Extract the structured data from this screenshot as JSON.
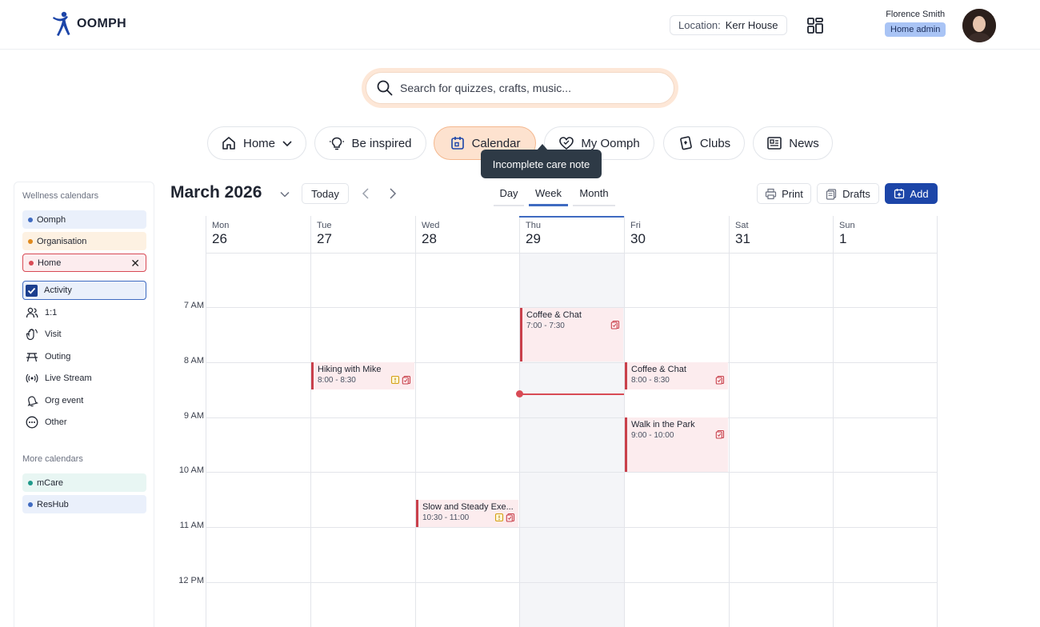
{
  "header": {
    "brand": "OOMPH",
    "location_label": "Location:",
    "location_value": "Kerr House",
    "user_name": "Florence Smith",
    "user_role": "Home admin"
  },
  "search": {
    "placeholder": "Search for quizzes, crafts, music..."
  },
  "nav": [
    {
      "label": "Home",
      "icon": "home-icon"
    },
    {
      "label": "Be inspired",
      "icon": "lightbulb-icon"
    },
    {
      "label": "Calendar",
      "icon": "calendar-icon",
      "active": true
    },
    {
      "label": "My Oomph",
      "icon": "heart-icon"
    },
    {
      "label": "Clubs",
      "icon": "clubs-icon"
    },
    {
      "label": "News",
      "icon": "newspaper-icon"
    }
  ],
  "tooltip": "Incomplete care note",
  "sidebar": {
    "wellness_heading": "Wellness calendars",
    "wellness": [
      {
        "label": "Oomph",
        "color": "#3f6bc1",
        "bg": "#eaf0fb"
      },
      {
        "label": "Organisation",
        "color": "#e08a1e",
        "bg": "#fdf1e2"
      },
      {
        "label": "Home",
        "color": "#d84a55",
        "bg": "#fcecee",
        "selected": true
      }
    ],
    "types": [
      {
        "label": "Activity",
        "icon": "checkbox-icon",
        "checked": true
      },
      {
        "label": "1:1",
        "icon": "people-icon"
      },
      {
        "label": "Visit",
        "icon": "wave-icon"
      },
      {
        "label": "Outing",
        "icon": "picnic-icon"
      },
      {
        "label": "Live Stream",
        "icon": "broadcast-icon"
      },
      {
        "label": "Org event",
        "icon": "bell-icon"
      },
      {
        "label": "Other",
        "icon": "more-icon"
      }
    ],
    "more_heading": "More calendars",
    "more": [
      {
        "label": "mCare",
        "color": "#1f9a8a",
        "bg": "#e8f6f3"
      },
      {
        "label": "ResHub",
        "color": "#3f6bc1",
        "bg": "#eaf0fb"
      }
    ]
  },
  "toolbar": {
    "month": "March 2026",
    "today": "Today",
    "views": [
      "Day",
      "Week",
      "Month"
    ],
    "active_view": "Week",
    "print": "Print",
    "drafts": "Drafts",
    "add": "Add"
  },
  "days": [
    {
      "name": "Mon",
      "num": "26"
    },
    {
      "name": "Tue",
      "num": "27"
    },
    {
      "name": "Wed",
      "num": "28"
    },
    {
      "name": "Thu",
      "num": "29",
      "today": true
    },
    {
      "name": "Fri",
      "num": "30"
    },
    {
      "name": "Sat",
      "num": "31"
    },
    {
      "name": "Sun",
      "num": "1"
    }
  ],
  "hours": [
    "7 AM",
    "8 AM",
    "9 AM",
    "10 AM",
    "11 AM",
    "12 PM"
  ],
  "events": [
    {
      "title": "Coffee & Chat",
      "time": "7:00 - 7:30",
      "day": 3,
      "start": 7.0,
      "end": 8.0,
      "icons": [
        "care-note-icon"
      ]
    },
    {
      "title": "Hiking with Mike",
      "time": "8:00 - 8:30",
      "day": 1,
      "start": 8.0,
      "end": 8.5,
      "icons": [
        "note-icon",
        "care-note-icon"
      ]
    },
    {
      "title": "Coffee & Chat",
      "time": "8:00 - 8:30",
      "day": 4,
      "start": 8.0,
      "end": 8.5,
      "icons": [
        "care-note-icon"
      ]
    },
    {
      "title": "Walk in the Park",
      "time": "9:00 - 10:00",
      "day": 4,
      "start": 9.0,
      "end": 10.0,
      "icons": [
        "care-note-icon"
      ]
    },
    {
      "title": "Slow and Steady Exe...",
      "time": "10:30 - 11:00",
      "day": 2,
      "start": 10.5,
      "end": 11.0,
      "icons": [
        "note-icon",
        "care-note-icon"
      ]
    }
  ]
}
